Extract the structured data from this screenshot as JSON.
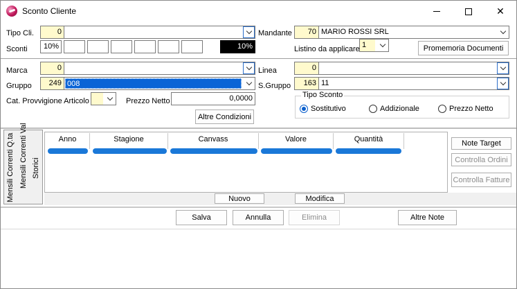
{
  "window": {
    "title": "Sconto Cliente",
    "controls": {
      "minimize": "minimize",
      "maximize": "maximize",
      "close": "✕"
    }
  },
  "top": {
    "tipo_cli_label": "Tipo Cli.",
    "tipo_cli_code": "0",
    "tipo_cli_value": "",
    "sconti_label": "Sconti",
    "sconti": [
      "10%",
      "",
      "",
      "",
      "",
      "",
      ""
    ],
    "sconto_totale": "10%",
    "mandante_label": "Mandante",
    "mandante_code": "70",
    "mandante_value": "MARIO ROSSI SRL",
    "listino_label": "Listino da applicare",
    "listino_value": "1",
    "promemoria_label": "Promemoria  Documenti"
  },
  "articolo": {
    "marca_label": "Marca",
    "marca_code": "0",
    "marca_value": "",
    "gruppo_label": "Gruppo",
    "gruppo_code": "249",
    "gruppo_value": "008",
    "cat_provv_label": "Cat. Provvigione Articolo",
    "cat_provv_value": "",
    "prezzo_netto_label": "Prezzo Netto",
    "prezzo_netto_value": "0,0000",
    "altre_condizioni_label": "Altre Condizioni",
    "linea_label": "Linea",
    "linea_code": "0",
    "linea_value": "",
    "sgruppo_label": "S.Gruppo",
    "sgruppo_code": "163",
    "sgruppo_value": "11",
    "tipo_sconto_label": "Tipo Sconto",
    "tipo_sconto_options": [
      "Sostitutivo",
      "Addizionale",
      "Prezzo Netto"
    ],
    "tipo_sconto_selected": "Sostitutivo"
  },
  "tabs": {
    "qta_label": "Mensili Correnti  Q.ta",
    "val_label": "Mensili Correnti  Val",
    "storici_label": "Storici"
  },
  "grid": {
    "columns": [
      "Anno",
      "Stagione",
      "Canvass",
      "Valore",
      "Quantità"
    ]
  },
  "side_buttons": {
    "note_target": "Note Target",
    "controlla_ordini": "Controlla Ordini",
    "controlla_fatture": "Controlla Fatture"
  },
  "grid_buttons": {
    "nuovo": "Nuovo",
    "modifica": "Modifica"
  },
  "footer": {
    "salva": "Salva",
    "annulla": "Annulla",
    "elimina": "Elimina",
    "altre_note": "Altre Note"
  },
  "colors": {
    "accent": "#0a5fcc",
    "highlight": "#1a78d8",
    "required": "#fffacd"
  }
}
